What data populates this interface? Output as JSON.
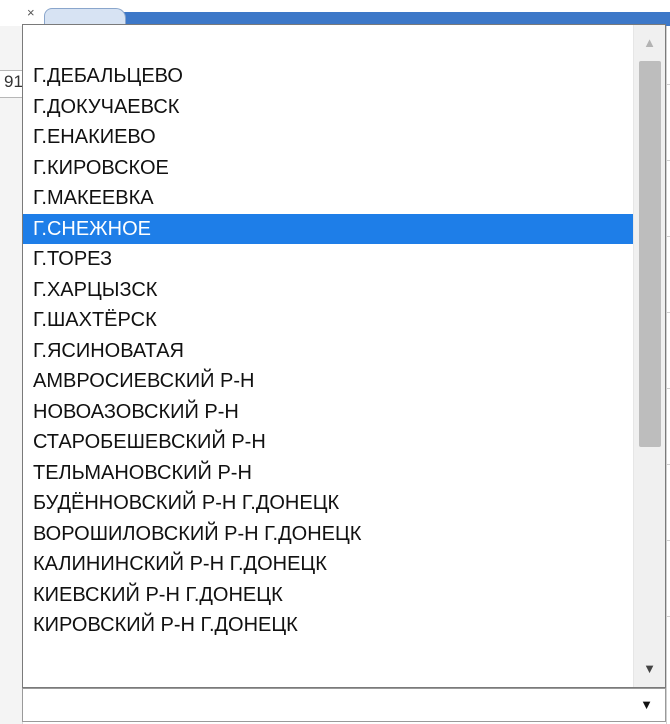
{
  "background": {
    "close_glyph": "×",
    "left_cell_text": "91",
    "tab_accent_color": "#3d78c8"
  },
  "dropdown": {
    "options": [
      "Г.ДЕБАЛЬЦЕВО",
      "Г.ДОКУЧАЕВСК",
      "Г.ЕНАКИЕВО",
      "Г.КИРОВСКОЕ",
      "Г.МАКЕЕВКА",
      "Г.СНЕЖНОЕ",
      "Г.ТОРЕЗ",
      "Г.ХАРЦЫЗСК",
      "Г.ШАХТЁРСК",
      "Г.ЯСИНОВАТАЯ",
      "АМВРОСИЕВСКИЙ Р-Н",
      "НОВОАЗОВСКИЙ Р-Н",
      "СТАРОБЕШЕВСКИЙ Р-Н",
      "ТЕЛЬМАНОВСКИЙ Р-Н",
      "БУДЁННОВСКИЙ Р-Н Г.ДОНЕЦК",
      "ВОРОШИЛОВСКИЙ Р-Н Г.ДОНЕЦК",
      "КАЛИНИНСКИЙ Р-Н Г.ДОНЕЦК",
      "КИЕВСКИЙ Р-Н Г.ДОНЕЦК",
      "КИРОВСКИЙ Р-Н Г.ДОНЕЦК"
    ],
    "selected_index": 5,
    "highlight_color": "#1e7ee8",
    "scroll_up_icon": "▲",
    "scroll_down_icon": "▼"
  },
  "select": {
    "current_value": "",
    "arrow_icon": "▼"
  }
}
